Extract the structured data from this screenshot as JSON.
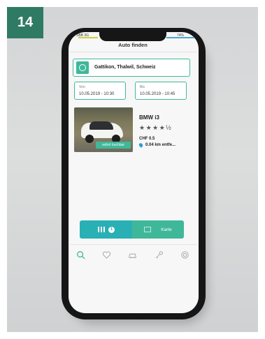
{
  "step_badge": "14",
  "status_bar": {
    "left": "SBB  3G",
    "right": "74%"
  },
  "header": {
    "title": "Auto finden"
  },
  "search": {
    "location": "Gattikon, Thalwil, Schweiz"
  },
  "dates": {
    "from_label": "Von",
    "from_value": "10.05.2019 - 10:30",
    "to_label": "Bis",
    "to_value": "10.05.2019 - 10:45"
  },
  "results": [
    {
      "name": "BMW i3",
      "rating_display": "★★★★½",
      "rating": 4.5,
      "price": "CHF 0.5",
      "distance": "0.04 km entfe...",
      "badge": "sofort buchbar"
    }
  ],
  "actions": {
    "filter_count": "1",
    "map_label": "Karte"
  },
  "tabs": [
    {
      "name": "search-icon",
      "active": true
    },
    {
      "name": "heart-icon",
      "active": false
    },
    {
      "name": "car-icon",
      "active": false
    },
    {
      "name": "key-icon",
      "active": false
    },
    {
      "name": "profile-icon",
      "active": false
    }
  ],
  "colors": {
    "brand": "#3fb89a",
    "filter": "#28b0b5",
    "badge": "#2f7a63"
  }
}
